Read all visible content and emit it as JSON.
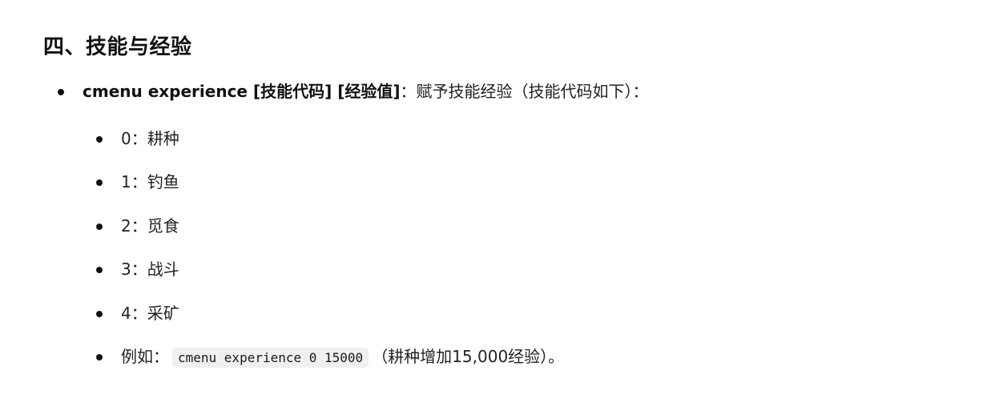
{
  "section": {
    "title": "四、技能与经验"
  },
  "command": {
    "syntax": "cmenu experience [技能代码] [经验值]",
    "description": "：赋予技能经验（技能代码如下）："
  },
  "skills": [
    {
      "code": "0",
      "sep": "：",
      "name": "耕种"
    },
    {
      "code": "1",
      "sep": "：",
      "name": "钓鱼"
    },
    {
      "code": "2",
      "sep": "：",
      "name": "觅食"
    },
    {
      "code": "3",
      "sep": "：",
      "name": "战斗"
    },
    {
      "code": "4",
      "sep": "：",
      "name": "采矿"
    }
  ],
  "example": {
    "label": "例如：",
    "code": "cmenu experience 0 15000",
    "note": "（耕种增加15,000经验）。"
  }
}
